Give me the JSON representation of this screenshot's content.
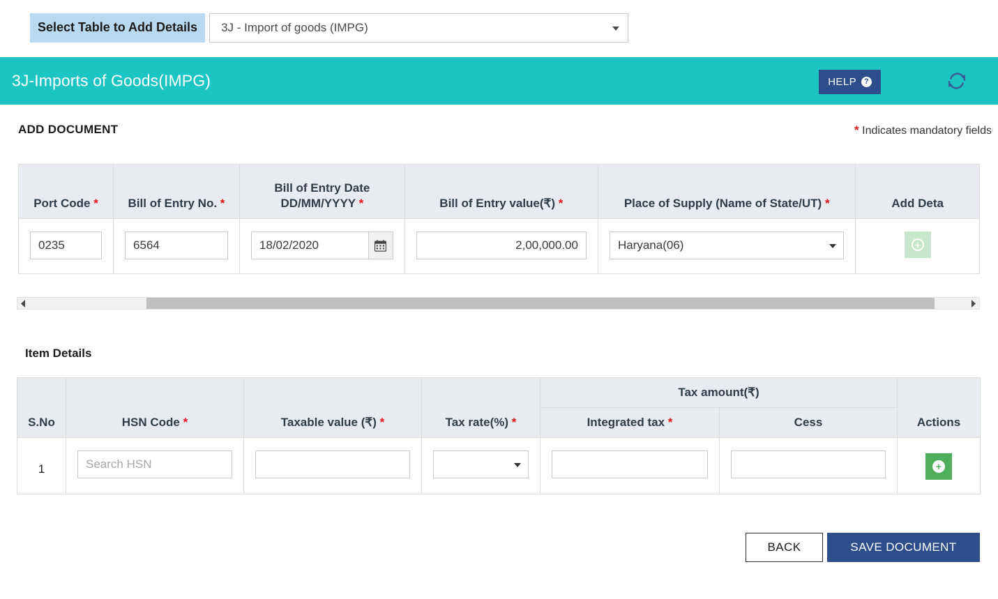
{
  "top_selector": {
    "label": "Select Table to Add Details",
    "selected_value": "3J - Import of goods (IMPG)",
    "caret_icon": "chevron-down-icon"
  },
  "header": {
    "title": "3J-Imports of Goods(IMPG)",
    "help_label": "HELP",
    "help_icon": "question-circle-icon",
    "refresh_icon": "refresh-icon",
    "background_color": "#1dc4c4",
    "help_button_color": "#2d4e8a"
  },
  "section": {
    "title": "ADD DOCUMENT",
    "mandatory_marker": "*",
    "mandatory_note": "Indicates mandatory fields",
    "required_color": "#e8131a"
  },
  "document_table": {
    "columns": [
      {
        "label": "Port Code",
        "required": true
      },
      {
        "label": "Bill of Entry No.",
        "required": true
      },
      {
        "label": "Bill of Entry Date",
        "label2": "DD/MM/YYYY",
        "required": true
      },
      {
        "label": "Bill of Entry value(₹)",
        "required": true
      },
      {
        "label": "Place of Supply (Name of State/UT)",
        "required": true
      },
      {
        "label": "Add Deta",
        "required": false
      }
    ],
    "row": {
      "port_code": "0235",
      "bill_of_entry_no": "6564",
      "bill_of_entry_date": "18/02/2020",
      "calendar_icon": "calendar-icon",
      "bill_of_entry_value": "2,00,000.00",
      "place_of_supply": "Haryana(06)",
      "add_details_icon": "plus-circle-icon"
    }
  },
  "scrollbar": {
    "left_arrow_icon": "chevron-left-icon",
    "right_arrow_icon": "chevron-right-icon"
  },
  "item_details": {
    "title": "Item Details",
    "columns": {
      "sno": "S.No",
      "hsn_code": "HSN Code",
      "taxable_value": "Taxable value (₹)",
      "tax_rate": "Tax rate(%)",
      "tax_amount_group": "Tax amount(₹)",
      "integrated_tax": "Integrated tax",
      "cess": "Cess",
      "actions": "Actions"
    },
    "row": {
      "sno": "1",
      "hsn_placeholder": "Search HSN",
      "hsn_value": "",
      "taxable_value": "",
      "tax_rate": "",
      "integrated_tax": "",
      "cess": "",
      "add_icon": "plus-circle-icon"
    }
  },
  "footer": {
    "back_label": "BACK",
    "save_label": "SAVE DOCUMENT",
    "save_color": "#2d4e8a"
  }
}
